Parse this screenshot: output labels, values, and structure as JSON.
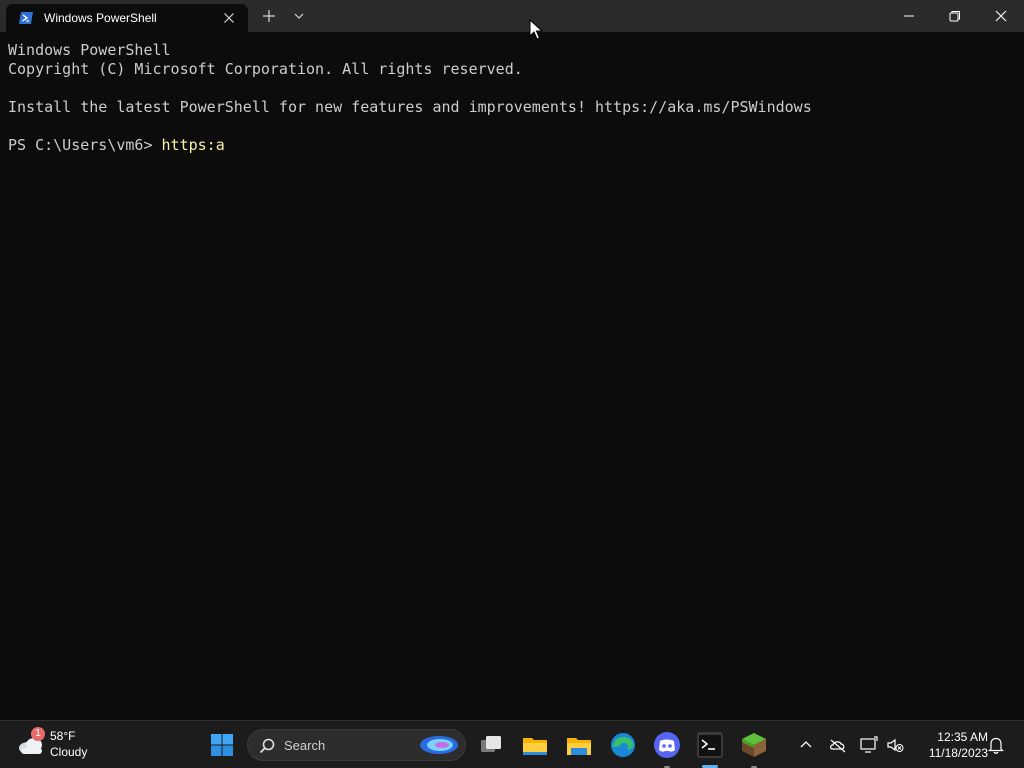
{
  "window": {
    "tab_title": "Windows PowerShell",
    "tab_icon": "powershell-icon"
  },
  "terminal": {
    "lines": [
      "Windows PowerShell",
      "Copyright (C) Microsoft Corporation. All rights reserved.",
      "",
      "Install the latest PowerShell for new features and improvements! https://aka.ms/PSWindows",
      ""
    ],
    "prompt": "PS C:\\Users\\vm6> ",
    "command": "https:a"
  },
  "taskbar": {
    "weather": {
      "temperature": "58°F",
      "condition": "Cloudy",
      "badge": "1"
    },
    "search_placeholder": "Search",
    "apps": [
      "start-icon",
      "task-view-icon",
      "file-explorer-icon",
      "file-explorer-icon",
      "edge-icon",
      "discord-icon",
      "terminal-icon",
      "minecraft-icon"
    ],
    "clock": {
      "time": "12:35 AM",
      "date": "11/18/2023"
    }
  },
  "colors": {
    "terminal_bg": "#0c0c0c",
    "terminal_text": "#cccccc",
    "command_text": "#f9f1a5",
    "titlebar_bg": "#2b2b2b",
    "taskbar_bg": "#1c1c1c",
    "accent": "#5fb2f2"
  }
}
